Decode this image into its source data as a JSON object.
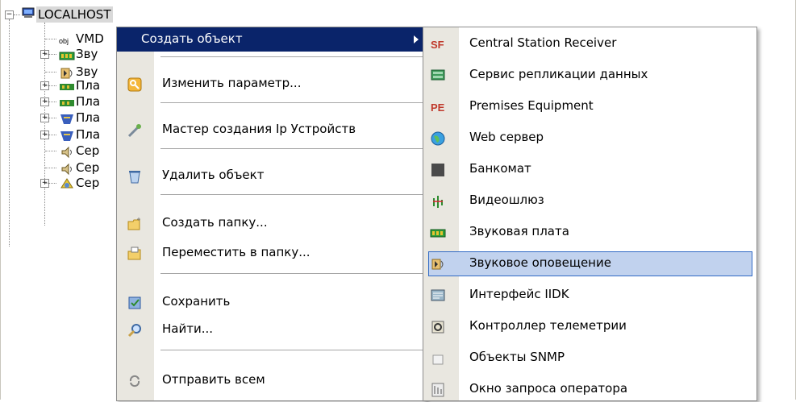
{
  "tree": {
    "root_label": "LOCALHOST",
    "items": [
      {
        "label": "VMD",
        "icon": "obj-text-icon",
        "expandable": false
      },
      {
        "label": "Зву",
        "icon": "sound-card-icon",
        "expandable": true
      },
      {
        "label": "Зву",
        "icon": "sound-alert-icon",
        "expandable": false
      },
      {
        "label": "Пла",
        "icon": "board-icon",
        "expandable": true
      },
      {
        "label": "Пла",
        "icon": "board-icon",
        "expandable": true
      },
      {
        "label": "Пла",
        "icon": "capture-board-icon",
        "expandable": true
      },
      {
        "label": "Пла",
        "icon": "capture-board-icon",
        "expandable": true
      },
      {
        "label": "Сер",
        "icon": "speaker-icon",
        "expandable": false
      },
      {
        "label": "Сер",
        "icon": "speaker-icon",
        "expandable": false
      },
      {
        "label": "Сер",
        "icon": "server-icon",
        "expandable": true
      }
    ]
  },
  "context_menu": {
    "items": [
      {
        "label": "Создать объект",
        "icon": "",
        "selected": true,
        "submenu": true
      },
      {
        "label": "Изменить параметр...",
        "icon": "key-icon"
      },
      {
        "label": "Мастер создания Ip Устройств",
        "icon": "wand-icon"
      },
      {
        "label": "Удалить объект",
        "icon": "recycle-bin-icon"
      },
      {
        "label": "Создать папку...",
        "icon": "new-folder-icon"
      },
      {
        "label": "Переместить в папку...",
        "icon": "move-folder-icon"
      },
      {
        "label": "Сохранить",
        "icon": "save-icon"
      },
      {
        "label": "Найти...",
        "icon": "magnifier-icon"
      },
      {
        "label": "Отправить всем",
        "icon": "refresh-icon"
      }
    ]
  },
  "submenu": {
    "items": [
      {
        "label": "Central Station Receiver",
        "icon": "sf-logo-icon",
        "icon_text": "SF"
      },
      {
        "label": "Сервис репликации данных",
        "icon": "replication-icon"
      },
      {
        "label": "Premises Equipment",
        "icon": "pe-logo-icon",
        "icon_text": "PE"
      },
      {
        "label": "Web сервер",
        "icon": "globe-icon"
      },
      {
        "label": "Банкомат",
        "icon": "atm-icon"
      },
      {
        "label": "Видеошлюз",
        "icon": "video-gateway-icon"
      },
      {
        "label": "Звуковая плата",
        "icon": "sound-card-icon"
      },
      {
        "label": "Звуковое оповещение",
        "icon": "sound-alert-icon",
        "highlighted": true
      },
      {
        "label": "Интерфейс IIDK",
        "icon": "interface-icon"
      },
      {
        "label": "Контроллер телеметрии",
        "icon": "telemetry-icon"
      },
      {
        "label": "Объекты SNMP",
        "icon": "snmp-icon"
      },
      {
        "label": "Окно запроса оператора",
        "icon": "operator-request-icon"
      }
    ]
  },
  "colors": {
    "menu_selected_bg": "#0a246a",
    "submenu_highlight_bg": "#c1d2ee",
    "submenu_highlight_border": "#316ac5",
    "gutter": "#e9e7e0"
  }
}
